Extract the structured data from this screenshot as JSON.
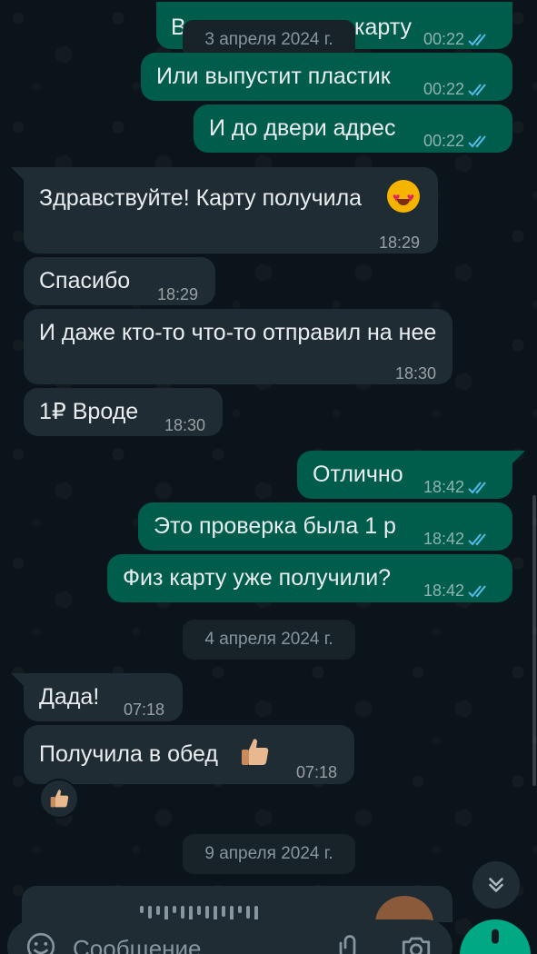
{
  "dates": [
    "3 апреля 2024 г.",
    "4 апреля 2024 г.",
    "9 апреля 2024 г."
  ],
  "messages": [
    {
      "text": "В",
      "tail_text": "карту",
      "time": "00:22",
      "dir": "out",
      "status": "read"
    },
    {
      "text": "Или выпустит пластик",
      "time": "00:22",
      "dir": "out",
      "status": "read"
    },
    {
      "text": "И до двери адрес",
      "time": "00:22",
      "dir": "out",
      "status": "read"
    },
    {
      "text": "Здравствуйте! Карту получила",
      "emoji": "heart-eyes",
      "time": "18:29",
      "dir": "in"
    },
    {
      "text": "Спасибо",
      "time": "18:29",
      "dir": "in"
    },
    {
      "text": "И даже кто-то что-то отправил на нее",
      "time": "18:30",
      "dir": "in"
    },
    {
      "text": "1₽ Вроде",
      "time": "18:30",
      "dir": "in"
    },
    {
      "text": "Отлично",
      "time": "18:42",
      "dir": "out",
      "status": "read"
    },
    {
      "text": "Это проверка была 1 р",
      "time": "18:42",
      "dir": "out",
      "status": "read"
    },
    {
      "text": "Физ карту уже получили?",
      "time": "18:42",
      "dir": "out",
      "status": "read"
    },
    {
      "text": "Дада!",
      "time": "07:18",
      "dir": "in"
    },
    {
      "text": "Получила в обед",
      "emoji": "thumbs-up",
      "time": "07:18",
      "dir": "in",
      "reaction": "thumbs-up"
    }
  ],
  "input": {
    "placeholder": "Сообщение"
  },
  "colors": {
    "background": "#0b141a",
    "incoming": "#202c33",
    "outgoing": "#005c4b",
    "read_checks": "#53bdeb",
    "accent": "#00a884"
  }
}
